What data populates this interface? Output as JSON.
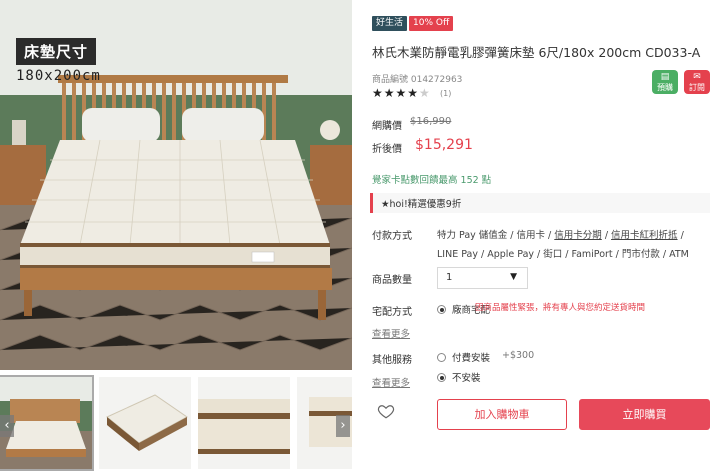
{
  "gallery": {
    "size_badge_title": "床墊尺寸",
    "size_badge_dims": "180x200cm",
    "prev_arrow": "‹",
    "next_arrow": "›"
  },
  "product": {
    "tags": {
      "good_life": "好生活",
      "discount": "10% Off"
    },
    "title": "林氏木業防靜電乳膠彈簧床墊 6尺/180x 200cm CD033-A",
    "product_no": "商品編號 014272963",
    "rating": {
      "stars": 4,
      "max": 5,
      "review_count": "(1)"
    },
    "actions": {
      "share_label": "預購",
      "subscribe_label": "訂閱"
    },
    "pricing": {
      "original_label": "網購價",
      "original_price": "$16,990",
      "sale_label": "折後價",
      "sale_price": "$15,291"
    },
    "points_note": "覺家卡點數回饋最高 152 點",
    "promo": "★hoi!精選優惠9折",
    "payment": {
      "label": "付款方式",
      "methods_line1_a": "特力 Pay 儲值金 / 信用卡 / ",
      "methods_line1_b": "信用卡分期",
      "methods_line1_c": " / ",
      "methods_line1_d": "信用卡紅利折抵",
      "methods_line1_e": " /",
      "methods_line2": "LINE Pay / Apple Pay / 街口 / FamiPort / 門市付款 / ATM"
    },
    "quantity": {
      "label": "商品數量",
      "value": "1"
    },
    "shipping": {
      "label": "宅配方式",
      "option": "廠商宅配",
      "note": "因商品屬性緊張，將有專人與您約定送貨時間",
      "more": "查看更多"
    },
    "services": {
      "label": "其他服務",
      "option_paid": "付費安裝",
      "option_paid_price": "+$300",
      "option_none": "不安裝",
      "more": "查看更多"
    },
    "buttons": {
      "add_to_cart": "加入購物車",
      "buy_now": "立即購買"
    }
  },
  "colors": {
    "accent": "#e4414d",
    "green": "#4bae64",
    "tag_dark": "#2f4f5c"
  }
}
